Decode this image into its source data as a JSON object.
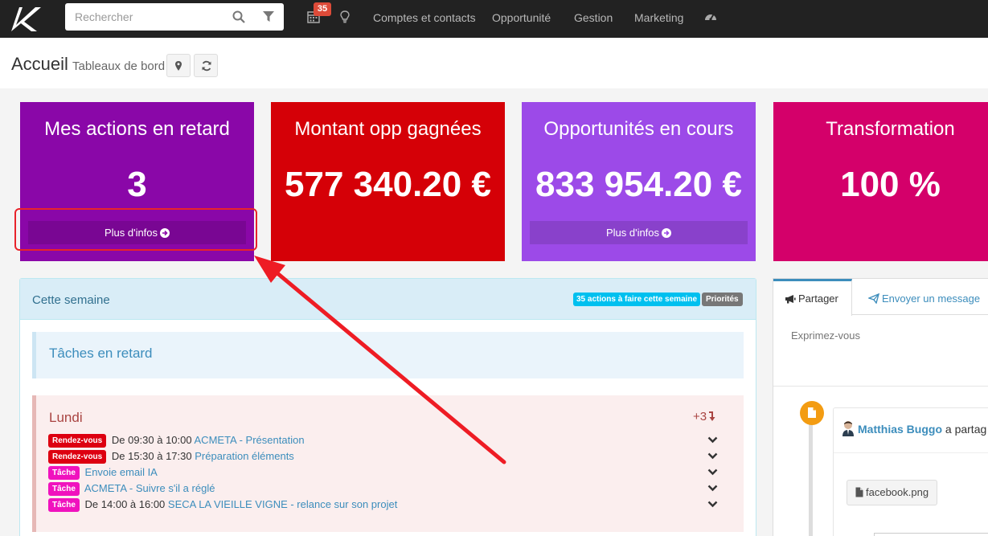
{
  "topbar": {
    "search_placeholder": "Rechercher",
    "calendar_badge": "35",
    "nav": [
      "Comptes et contacts",
      "Opportunité",
      "Gestion",
      "Marketing"
    ]
  },
  "header": {
    "title": "Accueil",
    "subtitle": "Tableaux de bord"
  },
  "kpis": [
    {
      "title": "Mes actions en retard",
      "value": "3",
      "more": "Plus d'infos",
      "color": "#8a07a8"
    },
    {
      "title": "Montant opp gagnées",
      "value": "577 340.20 €",
      "color": "#d50007"
    },
    {
      "title": "Opportunités en cours",
      "value": "833 954.20 €",
      "more": "Plus d'infos",
      "color": "#9c4ae8"
    },
    {
      "title": "Transformation",
      "value": "100 %",
      "color": "#d4006a"
    }
  ],
  "week": {
    "title": "Cette semaine",
    "badge_actions": "35 actions à faire cette semaine",
    "badge_priorities": "Priorités",
    "late_title": "Tâches en retard",
    "day": {
      "title": "Lundi",
      "more": "+3",
      "rows": [
        {
          "tag": "Rendez-vous",
          "time": "De 09:30 à 10:00",
          "link": "ACMETA - Présentation"
        },
        {
          "tag": "Rendez-vous",
          "time": "De 15:30 à 17:30",
          "link": "Préparation éléments"
        },
        {
          "tag": "Tâche",
          "time": "",
          "link": "Envoie email IA"
        },
        {
          "tag": "Tâche",
          "time": "",
          "link": "ACMETA - Suivre s'il a réglé"
        },
        {
          "tag": "Tâche",
          "time": "De 14:00 à 16:00",
          "link": "SECA LA VIEILLE VIGNE - relance sur son projet"
        }
      ]
    }
  },
  "social": {
    "tab_share": "Partager",
    "tab_message": "Envoyer un message",
    "placeholder": "Exprimez-vous",
    "author": "Matthias Buggo",
    "action": "a partag",
    "file": "facebook.png"
  }
}
